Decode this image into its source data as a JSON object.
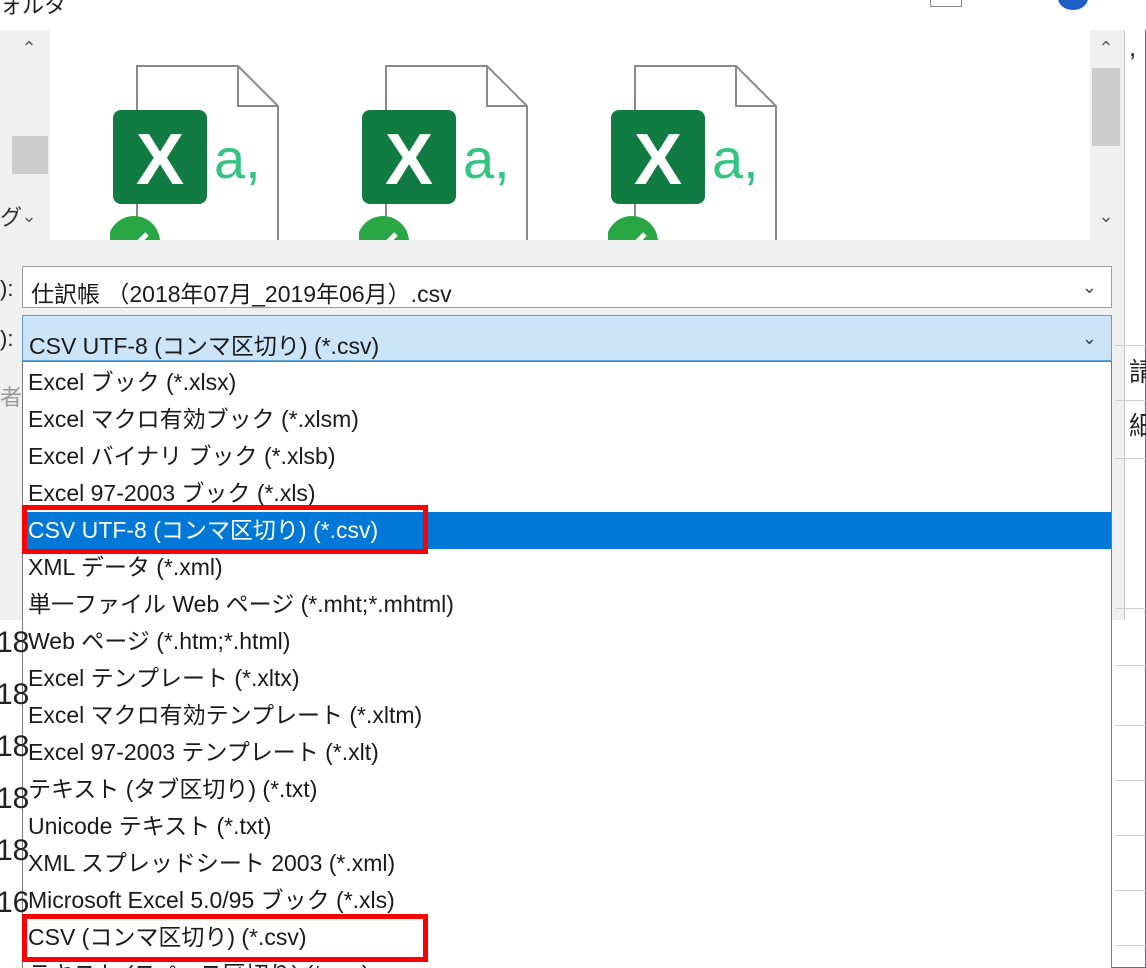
{
  "title_fragment": "ォルタ",
  "dialog": {
    "file_name_label": "):",
    "file_type_label": "):",
    "side_char_gu": "グ",
    "side_char_gray": "者:",
    "file_name_value": "仕訳帳 （2018年07月_2019年06月）.csv",
    "file_type_value": "CSV UTF-8 (コンマ区切り) (*.csv)",
    "scroll_up": "⌃",
    "scroll_down": "⌄",
    "chevron": "⌄",
    "file_icon_letter": "X",
    "file_icon_text": "a,"
  },
  "file_types": [
    "Excel ブック (*.xlsx)",
    "Excel マクロ有効ブック (*.xlsm)",
    "Excel バイナリ ブック (*.xlsb)",
    "Excel 97-2003 ブック (*.xls)",
    "CSV UTF-8 (コンマ区切り) (*.csv)",
    "XML データ (*.xml)",
    "単一ファイル Web ページ (*.mht;*.mhtml)",
    "Web ページ (*.htm;*.html)",
    "Excel テンプレート (*.xltx)",
    "Excel マクロ有効テンプレート (*.xltm)",
    "Excel 97-2003 テンプレート (*.xlt)",
    "テキスト (タブ区切り) (*.txt)",
    "Unicode テキスト (*.txt)",
    "XML スプレッドシート 2003 (*.xml)",
    "Microsoft Excel 5.0/95 ブック (*.xls)",
    "CSV (コンマ区切り) (*.csv)",
    "テキスト (スペース区切り) (*.prn)"
  ],
  "selected_index": 4,
  "highlighted_items": [
    4,
    15
  ],
  "background": {
    "row_fragments": [
      "18",
      "18",
      "18",
      "18",
      "18",
      "16"
    ],
    "right_fragments": [
      "請",
      "細",
      ","
    ]
  },
  "colors": {
    "excel_green": "#107c41",
    "selection": "#0078d7",
    "highlight_box": "#ff0000",
    "checkmark": "#2aa745"
  }
}
